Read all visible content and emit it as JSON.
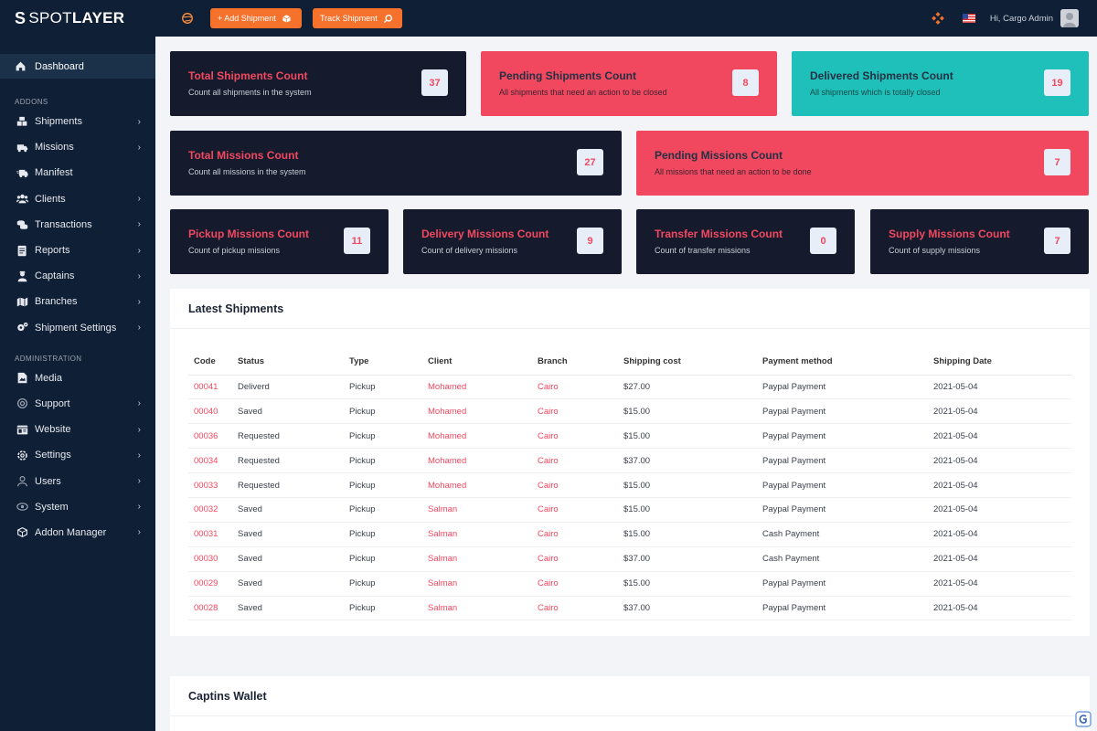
{
  "brand": {
    "mark": "S",
    "spot": "SPOT",
    "layer": "LAYER"
  },
  "sidebar": {
    "active": "Dashboard",
    "addons_heading": "ADDONS",
    "addons": [
      {
        "label": "Shipments",
        "icon": "boxes-icon",
        "chevron": true
      },
      {
        "label": "Missions",
        "icon": "truck-icon",
        "chevron": true
      },
      {
        "label": "Manifest",
        "icon": "truck-fast-icon",
        "chevron": false
      },
      {
        "label": "Clients",
        "icon": "users-icon",
        "chevron": true
      },
      {
        "label": "Transactions",
        "icon": "coins-icon",
        "chevron": true
      },
      {
        "label": "Reports",
        "icon": "report-icon",
        "chevron": true
      },
      {
        "label": "Captains",
        "icon": "captain-icon",
        "chevron": true
      },
      {
        "label": "Branches",
        "icon": "map-icon",
        "chevron": true
      },
      {
        "label": "Shipment Settings",
        "icon": "gears-icon",
        "chevron": true
      }
    ],
    "admin_heading": "ADMINISTRATION",
    "admin": [
      {
        "label": "Media",
        "icon": "media-icon",
        "chevron": false
      },
      {
        "label": "Support",
        "icon": "support-icon",
        "chevron": true
      },
      {
        "label": "Website",
        "icon": "website-icon",
        "chevron": true
      },
      {
        "label": "Settings",
        "icon": "gear-icon",
        "chevron": true
      },
      {
        "label": "Users",
        "icon": "user-icon",
        "chevron": true
      },
      {
        "label": "System",
        "icon": "system-icon",
        "chevron": true
      },
      {
        "label": "Addon Manager",
        "icon": "box-icon",
        "chevron": true
      }
    ]
  },
  "topbar": {
    "add_shipment": "+ Add Shipment",
    "track_shipment": "Track Shipment",
    "greeting": "Hi, Cargo Admin"
  },
  "cards": [
    {
      "title": "Total Shipments Count",
      "sub": "Count all shipments in the system",
      "count": "37"
    },
    {
      "title": "Pending Shipments Count",
      "sub": "All shipments that need an action to be closed",
      "count": "8"
    },
    {
      "title": "Delivered Shipments Count",
      "sub": "All shipments which is totally closed",
      "count": "19"
    },
    {
      "title": "Total Missions Count",
      "sub": "Count all missions in the system",
      "count": "27"
    },
    {
      "title": "Pending Missions Count",
      "sub": "All missions that need an action to be done",
      "count": "7"
    },
    {
      "title": "Pickup Missions Count",
      "sub": "Count of pickup missions",
      "count": "11"
    },
    {
      "title": "Delivery Missions Count",
      "sub": "Count of delivery missions",
      "count": "9"
    },
    {
      "title": "Transfer Missions Count",
      "sub": "Count of transfer missions",
      "count": "0"
    },
    {
      "title": "Supply Missions Count",
      "sub": "Count of supply missions",
      "count": "7"
    }
  ],
  "latest": {
    "title": "Latest Shipments",
    "columns": [
      "Code",
      "Status",
      "Type",
      "Client",
      "Branch",
      "Shipping cost",
      "Payment method",
      "Shipping Date"
    ],
    "rows": [
      [
        "00041",
        "Deliverd",
        "Pickup",
        "Mohamed",
        "Cairo",
        "$27.00",
        "Paypal Payment",
        "2021-05-04"
      ],
      [
        "00040",
        "Saved",
        "Pickup",
        "Mohamed",
        "Cairo",
        "$15.00",
        "Paypal Payment",
        "2021-05-04"
      ],
      [
        "00036",
        "Requested",
        "Pickup",
        "Mohamed",
        "Cairo",
        "$15.00",
        "Paypal Payment",
        "2021-05-04"
      ],
      [
        "00034",
        "Requested",
        "Pickup",
        "Mohamed",
        "Cairo",
        "$37.00",
        "Paypal Payment",
        "2021-05-04"
      ],
      [
        "00033",
        "Requested",
        "Pickup",
        "Mohamed",
        "Cairo",
        "$15.00",
        "Paypal Payment",
        "2021-05-04"
      ],
      [
        "00032",
        "Saved",
        "Pickup",
        "Salman",
        "Cairo",
        "$15.00",
        "Paypal Payment",
        "2021-05-04"
      ],
      [
        "00031",
        "Saved",
        "Pickup",
        "Salman",
        "Cairo",
        "$15.00",
        "Cash Payment",
        "2021-05-04"
      ],
      [
        "00030",
        "Saved",
        "Pickup",
        "Salman",
        "Cairo",
        "$37.00",
        "Cash Payment",
        "2021-05-04"
      ],
      [
        "00029",
        "Saved",
        "Pickup",
        "Salman",
        "Cairo",
        "$15.00",
        "Paypal Payment",
        "2021-05-04"
      ],
      [
        "00028",
        "Saved",
        "Pickup",
        "Salman",
        "Cairo",
        "$37.00",
        "Paypal Payment",
        "2021-05-04"
      ]
    ]
  },
  "wallet": {
    "title": "Captins Wallet"
  },
  "colors": {
    "sidebar": "#0f1f35",
    "accent": "#f5712c",
    "danger": "#f2485f",
    "teal": "#1ec0b9",
    "dark_card": "#151b2d"
  }
}
